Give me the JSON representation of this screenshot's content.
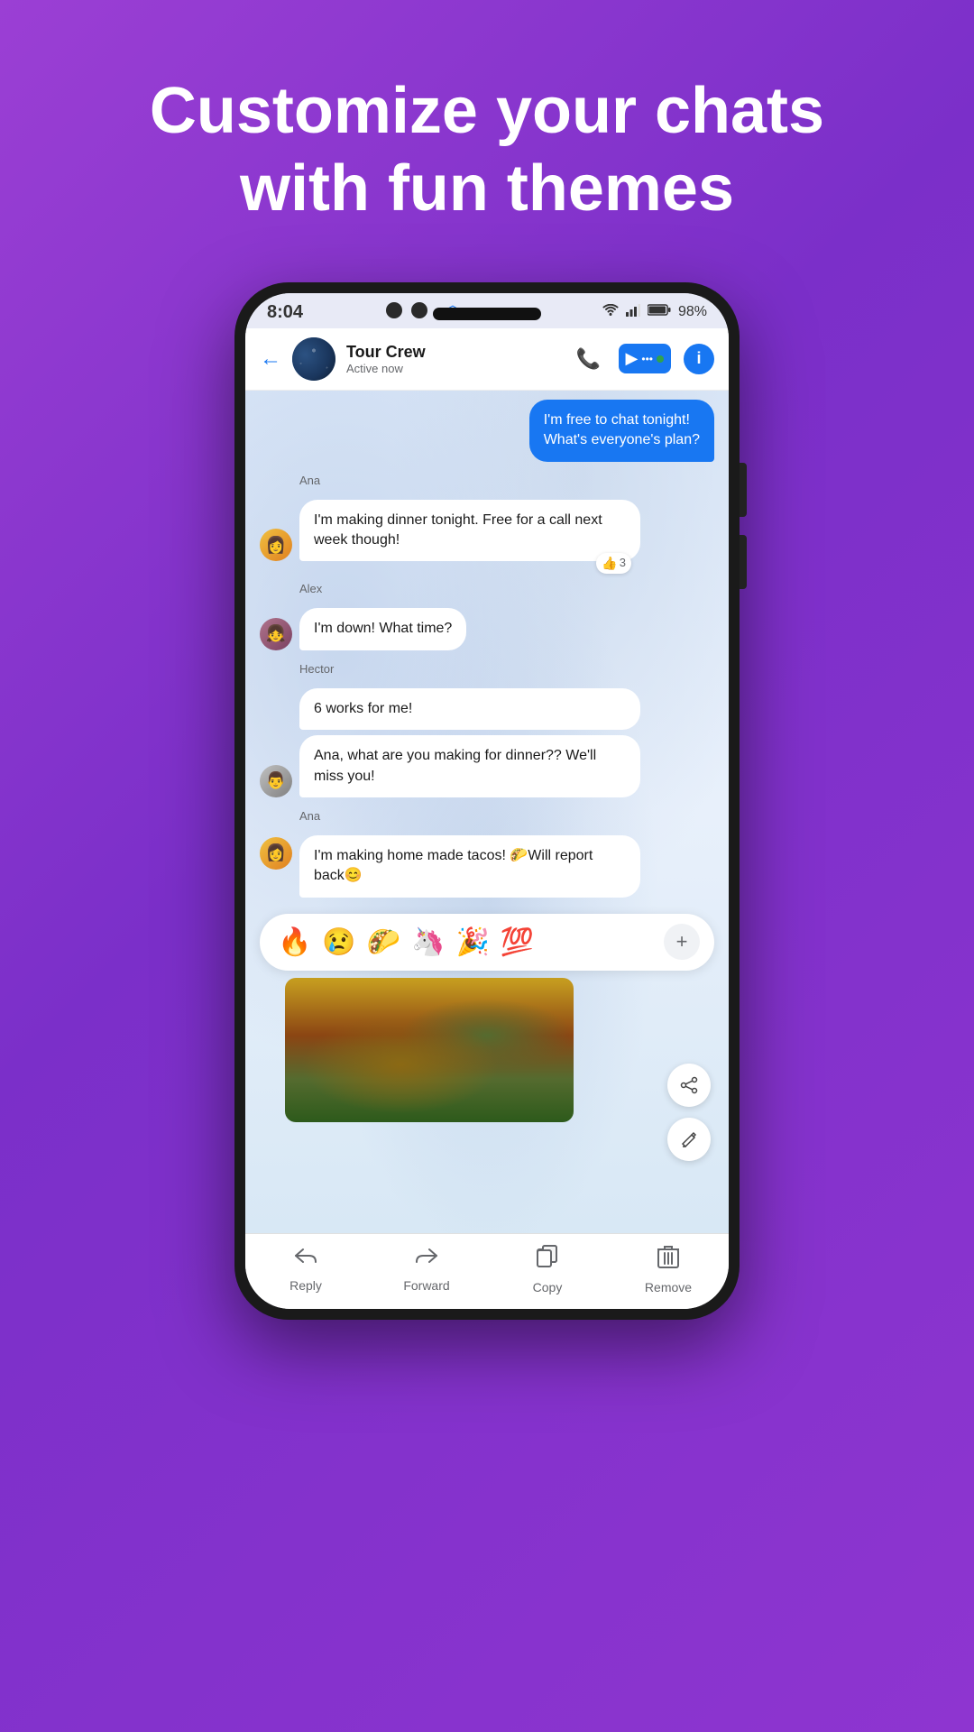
{
  "headline": {
    "line1": "Customize your chats",
    "line2": "with fun themes"
  },
  "status_bar": {
    "time": "8:04",
    "battery": "98%"
  },
  "header": {
    "back_label": "←",
    "group_name": "Tour Crew",
    "status": "Active now",
    "info_label": "i"
  },
  "messages": [
    {
      "type": "sent",
      "text": "I'm free to chat tonight! What's everyone's plan?"
    },
    {
      "type": "received",
      "sender": "Ana",
      "text": "I'm making dinner tonight. Free for a call next week though!",
      "reaction": "👍",
      "reaction_count": "3"
    },
    {
      "type": "received",
      "sender": "Alex",
      "text": "I'm down! What time?"
    },
    {
      "type": "received",
      "sender": "Hector",
      "text1": "6 works for me!",
      "text2": "Ana, what are you making for dinner?? We'll miss you!"
    },
    {
      "type": "received",
      "sender": "Ana",
      "text": "I'm making home made tacos! 🌮Will report back😊"
    }
  ],
  "reactions": {
    "emojis": [
      "🔥",
      "😢",
      "🌮",
      "🦄",
      "🎉",
      "💯"
    ]
  },
  "float_actions": {
    "share": "⬆",
    "edit": "✏"
  },
  "bottom_bar": {
    "reply": "Reply",
    "forward": "Forward",
    "copy": "Copy",
    "remove": "Remove"
  }
}
